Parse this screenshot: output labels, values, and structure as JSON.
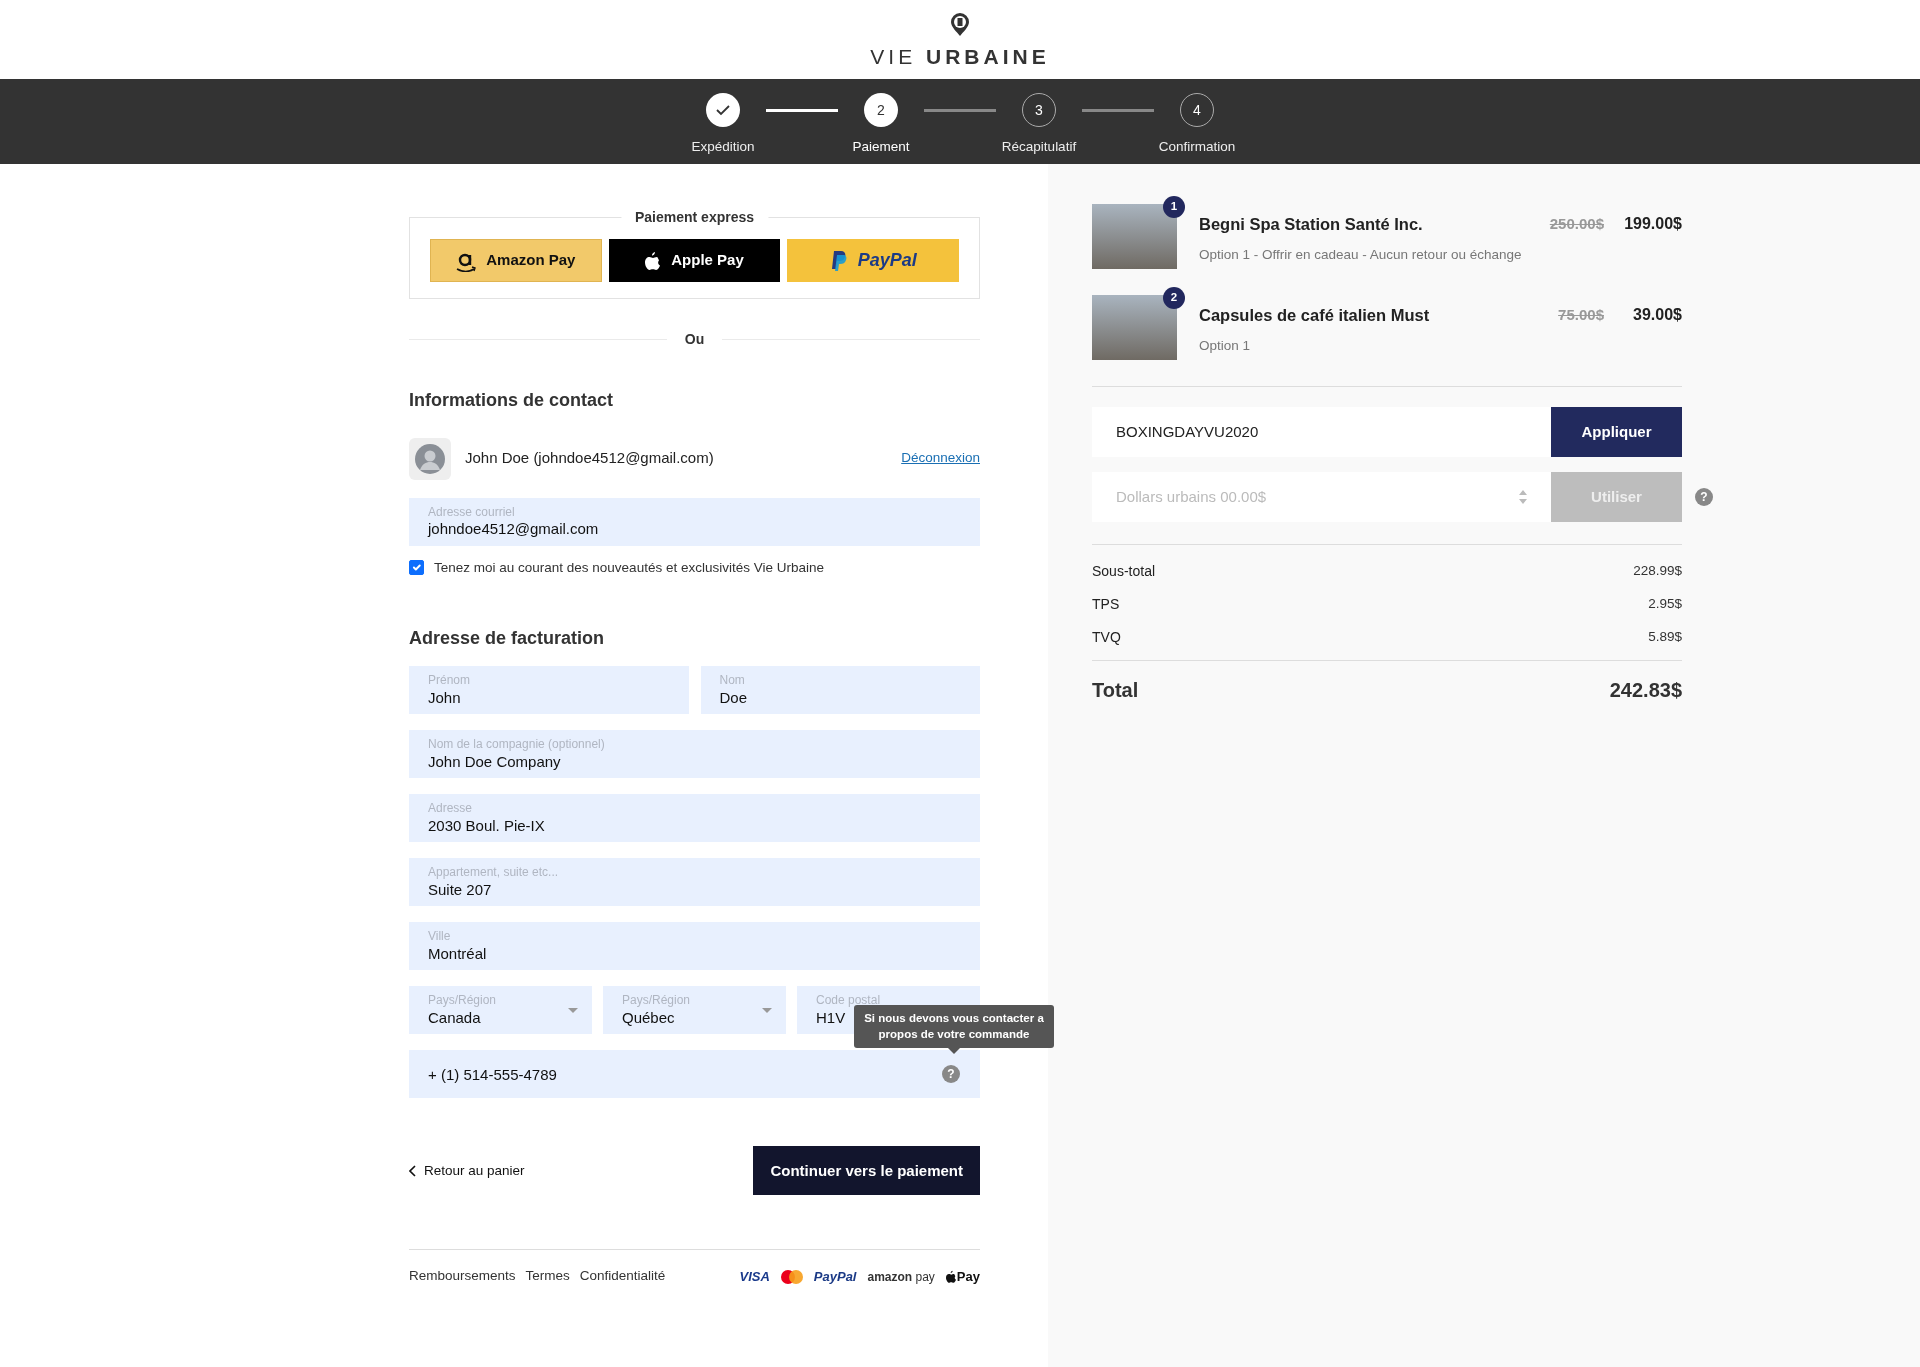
{
  "logo": {
    "light": "VIE",
    "bold": "URBAINE"
  },
  "steps": [
    {
      "label": "Expédition",
      "completed": true,
      "selected": false
    },
    {
      "number": "2",
      "label": "Paiement",
      "completed": false,
      "selected": true
    },
    {
      "number": "3",
      "label": "Récapitulatif",
      "completed": false,
      "selected": false
    },
    {
      "number": "4",
      "label": "Confirmation",
      "completed": false,
      "selected": false
    }
  ],
  "express": {
    "title": "Paiement express",
    "buttons": [
      {
        "kind": "amazon",
        "label": "Amazon Pay"
      },
      {
        "kind": "apple",
        "label": "Apple Pay"
      },
      {
        "kind": "paypal",
        "label": "PayPal"
      }
    ]
  },
  "separator": "Ou",
  "contact": {
    "heading": "Informations de contact",
    "user": "John Doe (johndoe4512@gmail.com)",
    "logout": "Déconnexion",
    "email": {
      "label": "Adresse courriel",
      "value": "johndoe4512@gmail.com"
    },
    "newsletter": {
      "label": "Tenez moi au courant des nouveautés et exclusivités Vie Urbaine",
      "checked": true
    }
  },
  "billing": {
    "heading": "Adresse de facturation",
    "rows": [
      [
        {
          "kind": "text",
          "label": "Prénom",
          "value": "John"
        },
        {
          "kind": "text",
          "label": "Nom",
          "value": "Doe"
        }
      ],
      [
        {
          "kind": "text",
          "label": "Nom de la compagnie (optionnel)",
          "value": "John Doe Company"
        }
      ],
      [
        {
          "kind": "text",
          "label": "Adresse",
          "value": "2030 Boul. Pie-IX"
        }
      ],
      [
        {
          "kind": "text",
          "label": "Appartement, suite etc...",
          "value": "Suite 207"
        }
      ],
      [
        {
          "kind": "text",
          "label": "Ville",
          "value": "Montréal"
        }
      ],
      [
        {
          "kind": "select",
          "label": "Pays/Région",
          "value": "Canada"
        },
        {
          "kind": "select",
          "label": "Pays/Région",
          "value": "Québec"
        },
        {
          "kind": "text",
          "label": "Code postal",
          "value": "H1V"
        }
      ]
    ],
    "phone": {
      "value": "+ (1) 514-555-4789",
      "help": "?",
      "tooltip": "Si nous devons vous contacter a propos de votre commande"
    }
  },
  "actions": {
    "back": "Retour au panier",
    "continue": "Continuer vers le paiement"
  },
  "footer": {
    "links": [
      "Remboursements",
      "Termes",
      "Confidentialité"
    ],
    "payment_marks": [
      {
        "kind": "visa",
        "text": "VISA"
      },
      {
        "kind": "mastercard"
      },
      {
        "kind": "paypal",
        "text": "PayPal"
      },
      {
        "kind": "amazonpay",
        "text": "**amazon** pay"
      },
      {
        "kind": "applepay",
        "text": "Pay"
      }
    ]
  },
  "summary": {
    "items": [
      {
        "quantity": "1",
        "name": "Begni Spa Station Santé Inc.",
        "option": "Option 1 - Offrir en cadeau - Aucun retour ou échange",
        "old_price": "250.00$",
        "price": "199.00$"
      },
      {
        "quantity": "2",
        "name": "Capsules de café italien Must",
        "option": "Option 1",
        "old_price": "75.00$",
        "price": "39.00$"
      }
    ],
    "promo": {
      "value": "BOXINGDAYVU2020",
      "button": "Appliquer"
    },
    "dollars": {
      "placeholder": "Dollars urbains 00.00$",
      "button": "Utiliser",
      "disabled": true,
      "help": "?"
    },
    "lines": [
      {
        "label": "Sous-total",
        "amount": "228.99$"
      },
      {
        "label": "TPS",
        "amount": "2.95$"
      },
      {
        "label": "TVQ",
        "amount": "5.89$"
      }
    ],
    "total": {
      "label": "Total",
      "amount": "242.83$"
    }
  }
}
